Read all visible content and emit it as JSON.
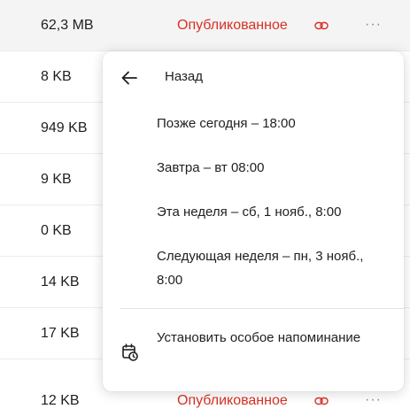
{
  "file_rows": [
    {
      "size": "62,3 MB",
      "status": "Опубликованное",
      "more": "···"
    },
    {
      "size": "8 KB"
    },
    {
      "size": "949 KB"
    },
    {
      "size": "9 KB"
    },
    {
      "size": "0 KB"
    },
    {
      "size": "14 KB"
    },
    {
      "size": "17 KB"
    },
    {
      "size": "12 KB",
      "status": "Опубликованное",
      "more": "···"
    }
  ],
  "snooze_menu": {
    "back_label": "Назад",
    "options": [
      {
        "label": "Позже сегодня – 18:00"
      },
      {
        "label": "Завтра – вт 08:00"
      },
      {
        "label": "Эта неделя – сб, 1 нояб., 8:00"
      },
      {
        "label": "Следующая неделя – пн, 3 нояб., 8:00"
      }
    ],
    "custom_label": "Установить особое напоминание"
  },
  "colors": {
    "published_status": "#d93025",
    "row_highlight": "#f4f4f4"
  },
  "icons": {
    "back": "arrow-left-icon",
    "link": "link-icon",
    "custom_reminder": "calendar-clock-icon"
  }
}
